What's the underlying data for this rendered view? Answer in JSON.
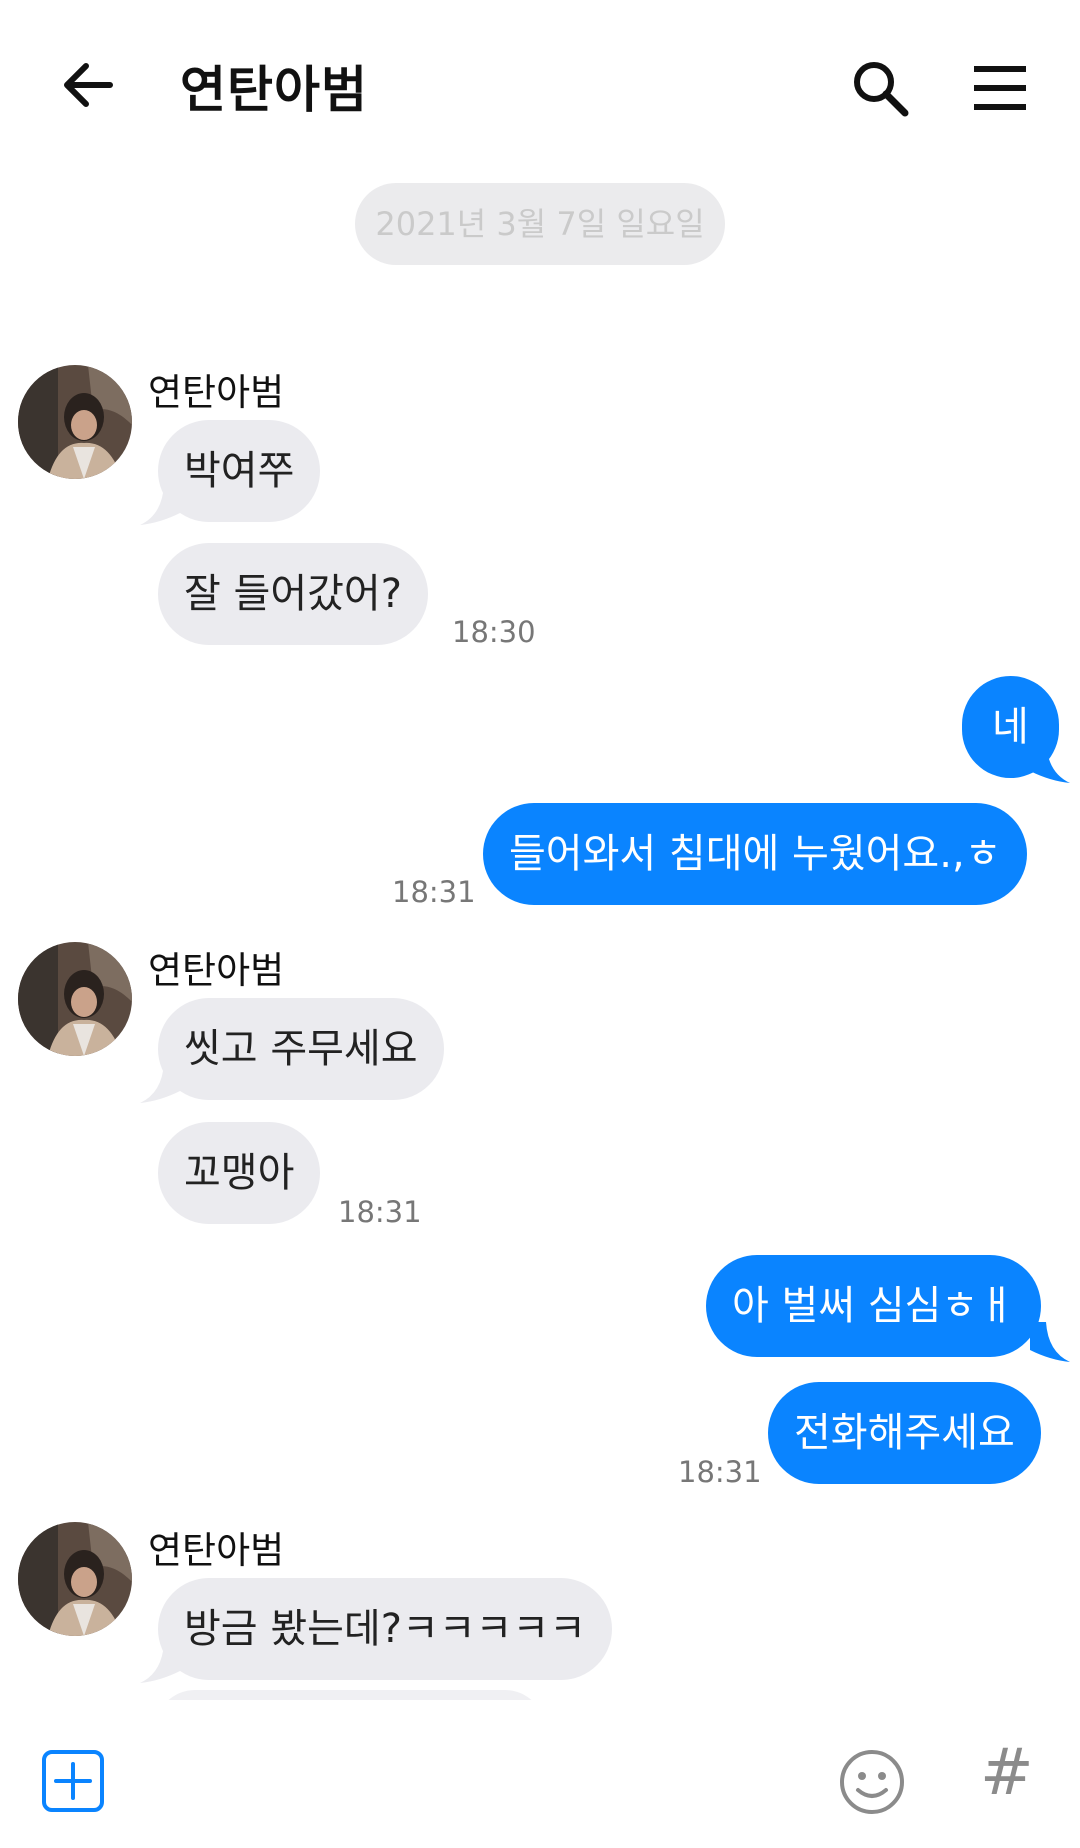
{
  "header": {
    "title": "연탄아범"
  },
  "date_separator": "2021년 3월 7일 일요일",
  "messages": [
    {
      "sender": "연탄아범",
      "text": "박여쭈"
    },
    {
      "text": "잘 들어갔어?",
      "time": "18:30"
    },
    {
      "text": "네"
    },
    {
      "text": "들어와서 침대에 누웠어요.,ㅎ",
      "time": "18:31"
    },
    {
      "sender": "연탄아범",
      "text": "씻고 주무세요"
    },
    {
      "text": "꼬맹아",
      "time": "18:31"
    },
    {
      "text": "아 벌써 심심ㅎㅐ"
    },
    {
      "text": "전화해주세요",
      "time": "18:31"
    },
    {
      "sender": "연탄아범",
      "text": "방금 봤는데?ㅋㅋㅋㅋㅋ"
    }
  ],
  "colors": {
    "accent": "#0a84ff",
    "incoming_bubble": "#ebebef",
    "date_chip": "#ebebed"
  },
  "icons": {
    "back": "arrow-left-icon",
    "search": "search-icon",
    "menu": "hamburger-menu-icon",
    "add": "plus-box-icon",
    "emoji": "smiley-icon",
    "hashtag": "hashtag-icon"
  }
}
